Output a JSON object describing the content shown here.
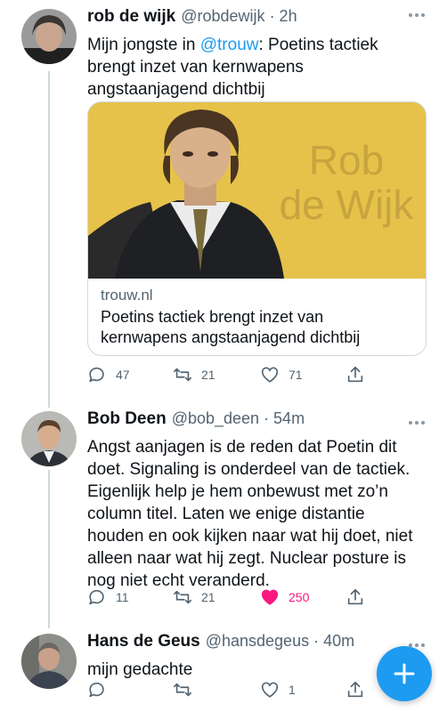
{
  "tweets": [
    {
      "name": "rob de wijk",
      "handle": "@robdewijk",
      "time": "· 2h",
      "text_before": "Mijn jongste in ",
      "mention": "@trouw",
      "text_after": ": Poetins tactiek brengt inzet van kernwapens angstaanjagend dichtbij",
      "card": {
        "image_caption_line1": "Rob",
        "image_caption_line2": "de Wijk",
        "domain": "trouw.nl",
        "title": "Poetins tactiek brengt inzet van kernwapens angstaanjagend dichtbij"
      },
      "replies": "47",
      "retweets": "21",
      "likes": "71"
    },
    {
      "name": "Bob Deen",
      "handle": "@bob_deen",
      "time": "· 54m",
      "text": "Angst aanjagen is de reden dat Poetin dit doet. Signaling is onderdeel van de tactiek. Eigenlijk help je hem onbewust met zo’n column titel. Laten we enige distantie houden en ook kijken naar wat hij doet, niet alleen naar wat hij zegt. Nuclear posture is nog niet echt veranderd.",
      "replies": "11",
      "retweets": "21",
      "likes": "250",
      "liked": true
    },
    {
      "name": "Hans de Geus",
      "handle": "@hansdegeus",
      "time": "· 40m",
      "text": "mijn gedachte",
      "replies": "",
      "retweets": "",
      "likes": "1"
    }
  ],
  "colors": {
    "accent": "#1d9bf0",
    "like": "#f91880",
    "muted": "#536471",
    "card_bg": "#e6c24a"
  },
  "icons": [
    "reply-icon",
    "retweet-icon",
    "like-icon",
    "share-icon",
    "more-icon",
    "compose-plus-icon"
  ]
}
